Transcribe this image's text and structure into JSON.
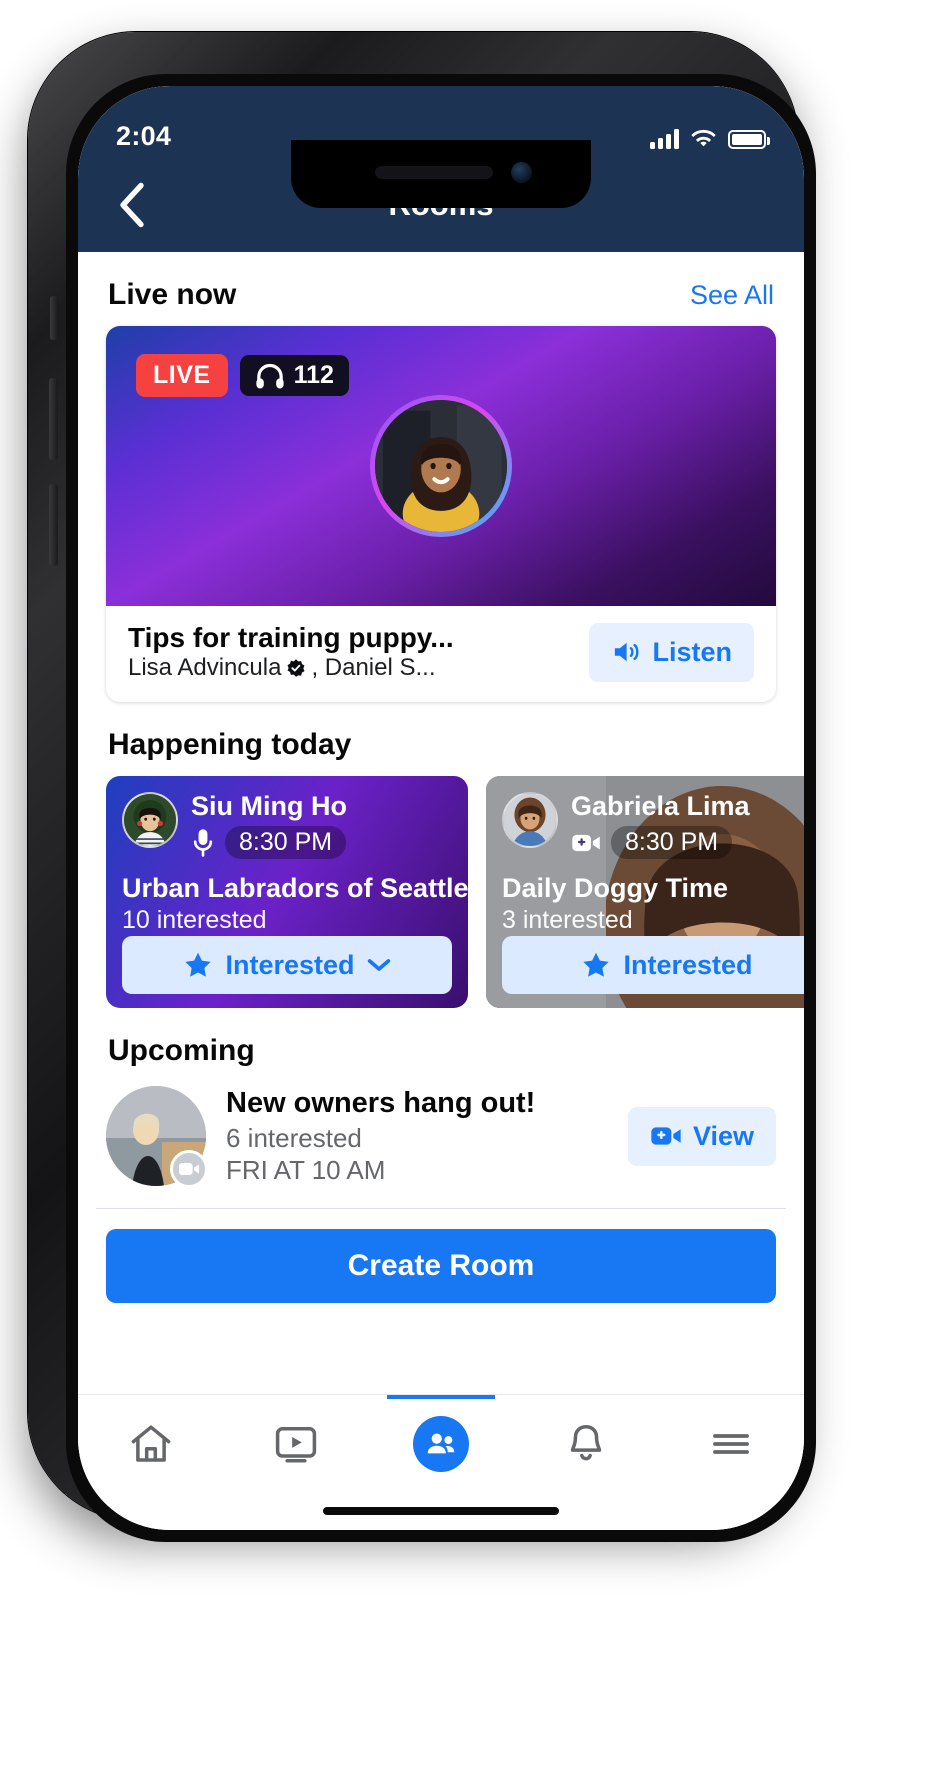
{
  "status_bar": {
    "time": "2:04",
    "signal_icon": "cellular-signal-icon",
    "wifi_icon": "wifi-icon",
    "battery_icon": "battery-full-icon"
  },
  "nav": {
    "back_icon": "chevron-left-icon",
    "title": "Rooms"
  },
  "live_now": {
    "section_title": "Live now",
    "see_all_label": "See All",
    "card": {
      "live_badge": "LIVE",
      "listener_count": "112",
      "headphones_icon": "headphones-icon",
      "avatar_name": "live-host-avatar",
      "title": "Tips for training puppy...",
      "hosts": "Lisa Advincula",
      "hosts_suffix": ", Daniel S...",
      "verified_icon": "verified-badge-icon",
      "listen_label": "Listen",
      "listen_icon": "speaker-icon"
    }
  },
  "happening_today": {
    "section_title": "Happening today",
    "cards": [
      {
        "host": "Siu Ming Ho",
        "type_icon": "microphone-icon",
        "time": "8:30 PM",
        "title": "Urban Labradors of Seattle",
        "interested": "10 interested",
        "cta_label": "Interested",
        "cta_icon": "star-icon",
        "cta_caret": "chevron-down-icon"
      },
      {
        "host": "Gabriela Lima",
        "type_icon": "video-camera-icon",
        "time": "8:30 PM",
        "title": "Daily Doggy Time",
        "interested": "3 interested",
        "cta_label": "Interested",
        "cta_icon": "star-icon",
        "cta_caret": ""
      }
    ]
  },
  "upcoming": {
    "section_title": "Upcoming",
    "item": {
      "title": "New owners hang out!",
      "interested": "6 interested",
      "date": "FRI AT 10 AM",
      "avatar_badge_icon": "video-camera-icon",
      "view_label": "View",
      "view_icon": "video-camera-plus-icon"
    }
  },
  "create_room": {
    "label": "Create Room"
  },
  "tabbar": {
    "items": [
      {
        "name": "home-icon",
        "active": false
      },
      {
        "name": "watch-icon",
        "active": false
      },
      {
        "name": "groups-icon",
        "active": true
      },
      {
        "name": "notifications-bell-icon",
        "active": false
      },
      {
        "name": "menu-hamburger-icon",
        "active": false
      }
    ]
  },
  "colors": {
    "header_blue": "#1c3354",
    "accent_blue": "#1877f2",
    "live_red": "#f5413f",
    "light_blue_bg": "#e7f0fe"
  }
}
